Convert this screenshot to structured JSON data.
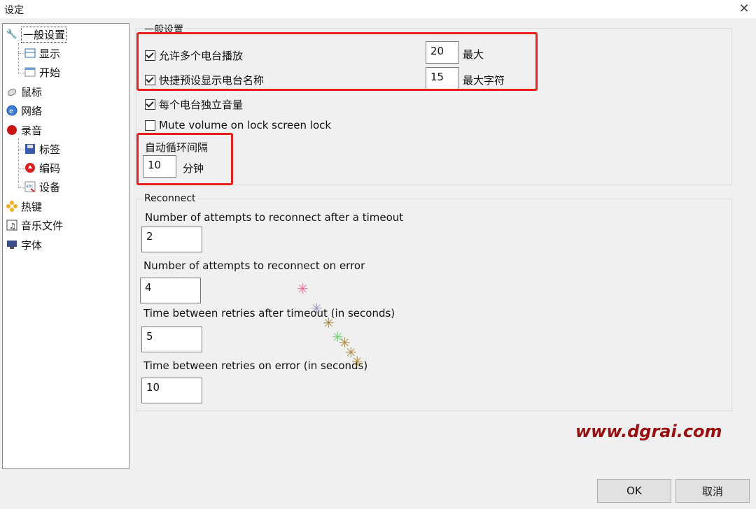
{
  "window": {
    "title": "设定",
    "close_glyph": "✕"
  },
  "tree": {
    "items": [
      {
        "label": "一般设置",
        "icon": "wrench-icon"
      },
      {
        "label": "显示",
        "icon": "display-icon"
      },
      {
        "label": "开始",
        "icon": "start-icon"
      },
      {
        "label": "鼠标",
        "icon": "mouse-icon"
      },
      {
        "label": "网络",
        "icon": "network-icon"
      },
      {
        "label": "录音",
        "icon": "record-icon"
      },
      {
        "label": "标签",
        "icon": "tag-icon"
      },
      {
        "label": "编码",
        "icon": "encode-icon"
      },
      {
        "label": "设备",
        "icon": "device-icon"
      },
      {
        "label": "热键",
        "icon": "hotkey-icon"
      },
      {
        "label": "音乐文件",
        "icon": "music-file-icon"
      },
      {
        "label": "字体",
        "icon": "font-icon"
      }
    ]
  },
  "general": {
    "title": "一般设置",
    "allow_multi": {
      "label": "允许多个电台播放",
      "checked": true,
      "value": "20",
      "unit": "最大"
    },
    "quick_preset": {
      "label": "快捷预设显示电台名称",
      "checked": true,
      "value": "15",
      "unit": "最大字符"
    },
    "independent_volume": {
      "label": "每个电台独立音量",
      "checked": true
    },
    "mute_lock": {
      "label": "Mute volume on lock screen lock",
      "checked": false
    },
    "auto_cycle": {
      "label": "自动循环间隔",
      "value": "10",
      "unit": "分钟"
    }
  },
  "reconnect": {
    "title": "Reconnect",
    "attempts_timeout": {
      "label": "Number of attempts to reconnect after a timeout",
      "value": "2"
    },
    "attempts_error": {
      "label": "Number of attempts to reconnect on error",
      "value": "4"
    },
    "time_timeout": {
      "label": "Time between retries after timeout (in seconds)",
      "value": "5"
    },
    "time_error": {
      "label": "Time between retries on error (in seconds)",
      "value": "10"
    }
  },
  "buttons": {
    "ok": "OK",
    "cancel": "取消"
  },
  "watermark": "www.dgrai.com",
  "colors": {
    "highlight_border": "#e8201c",
    "watermark": "#9a1010"
  }
}
